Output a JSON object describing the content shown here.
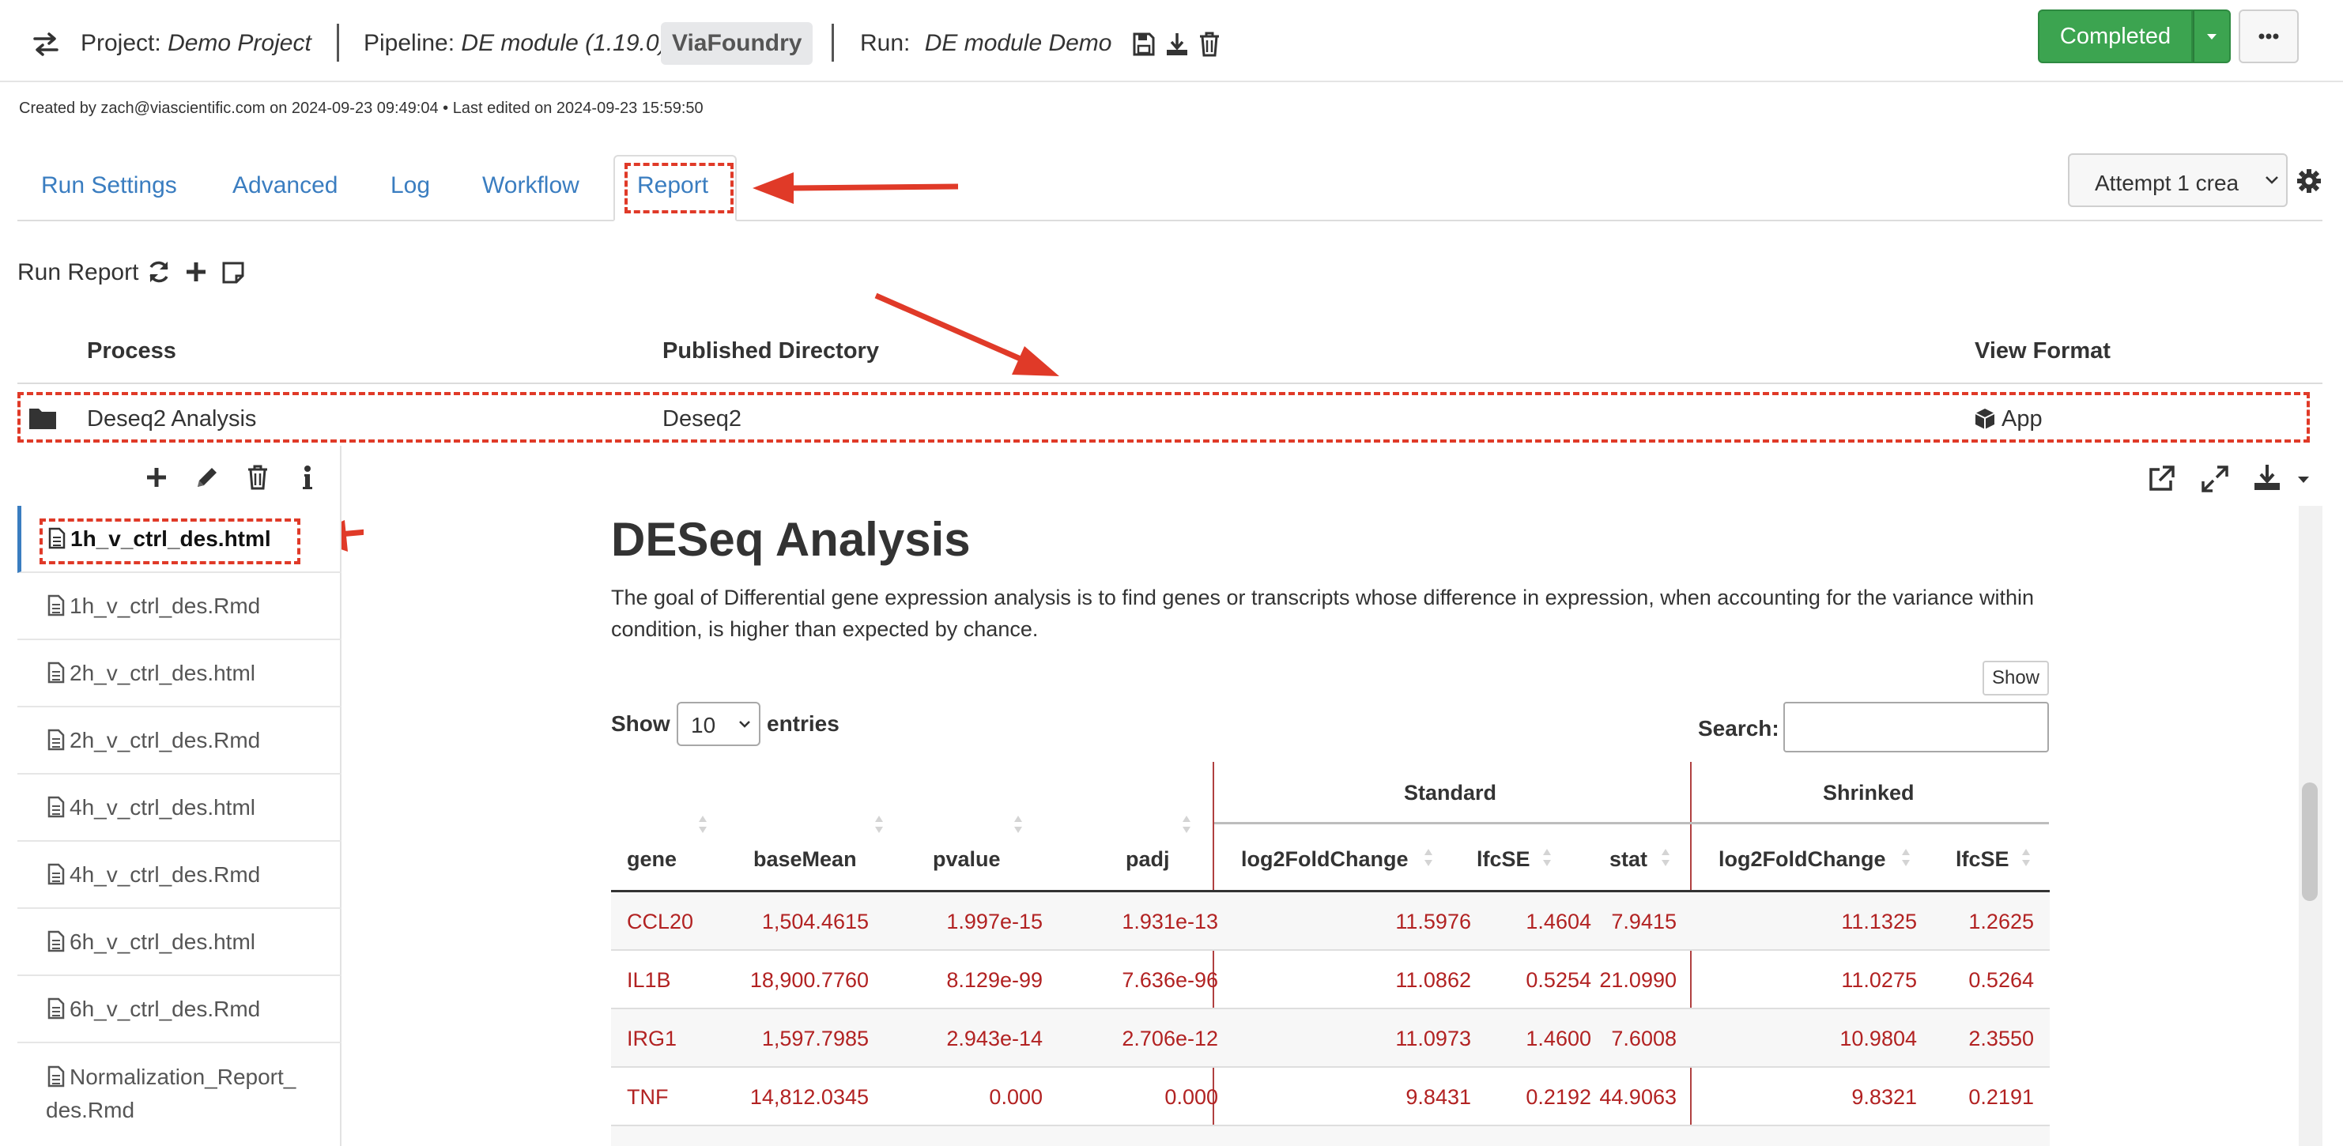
{
  "header": {
    "project_label": "Project:",
    "project_name": "Demo Project",
    "pipeline_label": "Pipeline:",
    "pipeline_name": "DE module (1.19.0)",
    "pipeline_badge": "ViaFoundry",
    "run_label": "Run:",
    "run_name": "DE module Demo",
    "status_button": "Completed",
    "meta": "Created by zach@viascientific.com on 2024-09-23 09:49:04 • Last edited on 2024-09-23 15:59:50"
  },
  "tabs": [
    {
      "label": "Run Settings"
    },
    {
      "label": "Advanced"
    },
    {
      "label": "Log"
    },
    {
      "label": "Workflow"
    },
    {
      "label": "Report",
      "active": true
    }
  ],
  "attempt_select": "Attempt 1 crea",
  "run_report": {
    "label": "Run Report"
  },
  "process_table": {
    "headers": [
      "Process",
      "Published Directory",
      "View Format"
    ],
    "row": {
      "process": "Deseq2 Analysis",
      "directory": "Deseq2",
      "format": "App"
    }
  },
  "files": [
    {
      "name": "1h_v_ctrl_des.html",
      "active": true
    },
    {
      "name": "1h_v_ctrl_des.Rmd"
    },
    {
      "name": "2h_v_ctrl_des.html"
    },
    {
      "name": "2h_v_ctrl_des.Rmd"
    },
    {
      "name": "4h_v_ctrl_des.html"
    },
    {
      "name": "4h_v_ctrl_des.Rmd"
    },
    {
      "name": "6h_v_ctrl_des.html"
    },
    {
      "name": "6h_v_ctrl_des.Rmd"
    },
    {
      "name_line1": "Normalization_Report_",
      "name_line2": "des.Rmd"
    }
  ],
  "report": {
    "title": "DESeq Analysis",
    "description": "The goal of Differential gene expression analysis is to find genes or transcripts whose difference in expression, when accounting for the variance within condition, is higher than expected by chance.",
    "show_button": "Show",
    "show_label": "Show",
    "entries_value": "10",
    "entries_label": "entries",
    "search_label": "Search:",
    "search_value": "",
    "group_headers": [
      "Standard",
      "Shrinked"
    ],
    "columns": [
      "gene",
      "baseMean",
      "pvalue",
      "padj",
      "log2FoldChange",
      "lfcSE",
      "stat",
      "log2FoldChange",
      "lfcSE"
    ],
    "rows": [
      [
        "CCL20",
        "1,504.4615",
        "1.997e-15",
        "1.931e-13",
        "11.5976",
        "1.4604",
        "7.9415",
        "11.1325",
        "1.2625"
      ],
      [
        "IL1B",
        "18,900.7760",
        "8.129e-99",
        "7.636e-96",
        "11.0862",
        "0.5254",
        "21.0990",
        "11.0275",
        "0.5264"
      ],
      [
        "IRG1",
        "1,597.7985",
        "2.943e-14",
        "2.706e-12",
        "11.0973",
        "1.4600",
        "7.6008",
        "10.9804",
        "2.3550"
      ],
      [
        "TNF",
        "14,812.0345",
        "0.000",
        "0.000",
        "9.8431",
        "0.2192",
        "44.9063",
        "9.8321",
        "0.2191"
      ]
    ]
  },
  "colors": {
    "link_blue": "#3a7dc0",
    "success_green": "#3ca450",
    "annotation_red": "#e03a28",
    "table_text_red": "#b22222"
  }
}
